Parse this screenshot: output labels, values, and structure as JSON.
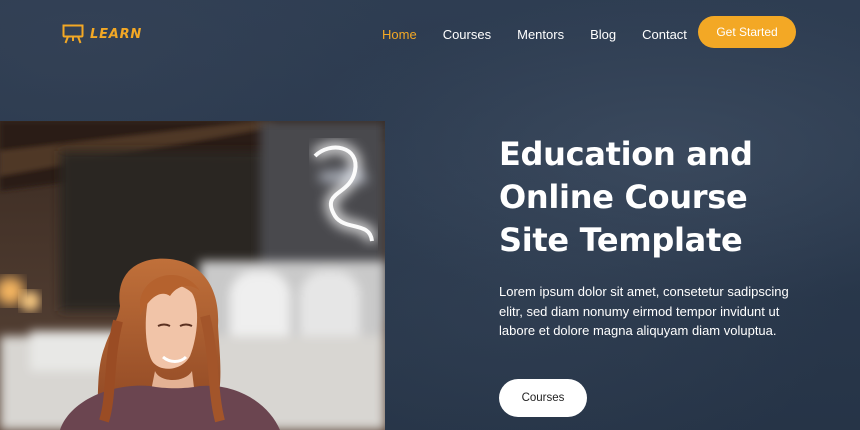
{
  "brand": {
    "name": "LEARN",
    "logo_icon": "presentation-board-icon",
    "accent": "#f3a825"
  },
  "nav": {
    "items": [
      {
        "label": "Home",
        "active": true
      },
      {
        "label": "Courses",
        "active": false
      },
      {
        "label": "Mentors",
        "active": false
      },
      {
        "label": "Blog",
        "active": false
      },
      {
        "label": "Contact",
        "active": false
      }
    ],
    "cta_label": "Get Started"
  },
  "hero": {
    "title_lines": [
      "Education and",
      "Online Course",
      "Site Template"
    ],
    "description": "Lorem ipsum dolor sit amet, consetetur sadipscing elitr, sed diam nonumy eirmod tempor invidunt ut labore et dolore magna aliquyam diam voluptua.",
    "button_label": "Courses"
  },
  "colors": {
    "background": "#2b3a4f",
    "accent": "#f3a825",
    "text": "#ffffff"
  }
}
